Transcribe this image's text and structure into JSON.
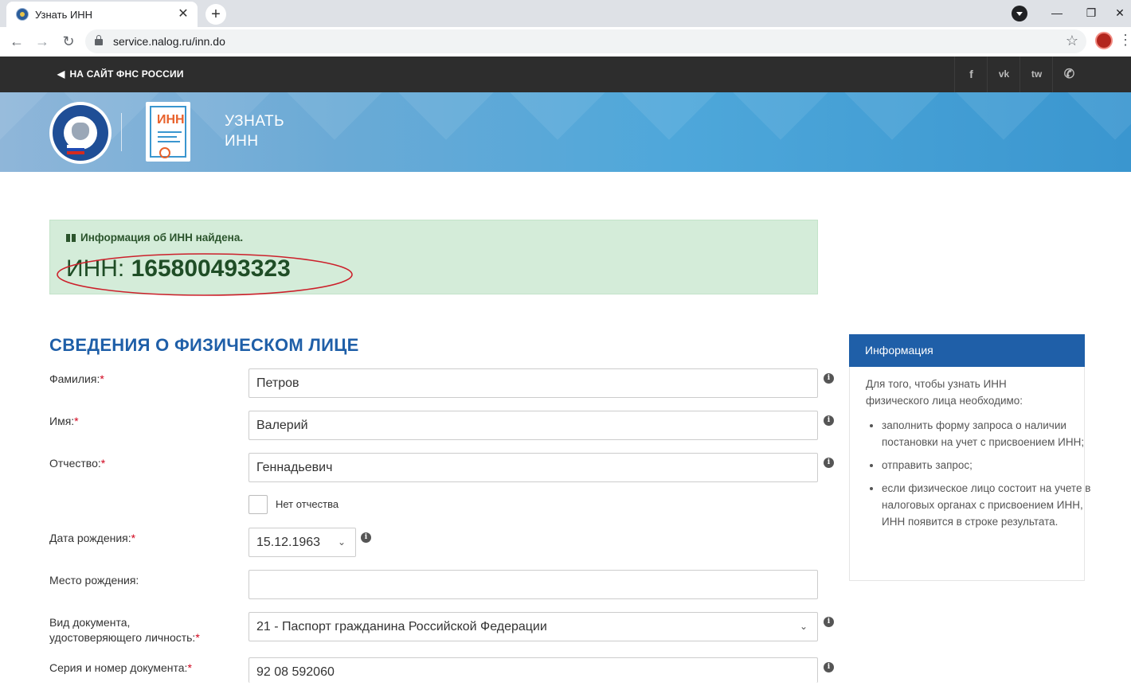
{
  "browser": {
    "tab_title": "Узнать ИНН",
    "tab_close": "✕",
    "new_tab": "+",
    "url": "service.nalog.ru/inn.do",
    "window_min": "—",
    "window_max": "❐",
    "window_close": "✕"
  },
  "topbar": {
    "back_link": "НА САЙТ ФНС РОССИИ",
    "social": [
      "f",
      "vk",
      "tw",
      "phone"
    ]
  },
  "banner": {
    "doc_icon_text": "ИНН",
    "title_line1": "УЗНАТЬ",
    "title_line2": "ИНН"
  },
  "result": {
    "heading": "Информация об ИНН найдена.",
    "inn_label": "ИНН:",
    "inn_value": "165800493323"
  },
  "form": {
    "section_title": "СВЕДЕНИЯ О ФИЗИЧЕСКОМ ЛИЦЕ",
    "surname_label": "Фамилия:",
    "surname_value": "Петров",
    "name_label": "Имя:",
    "name_value": "Валерий",
    "patronymic_label": "Отчество:",
    "patronymic_value": "Геннадьевич",
    "no_patronymic_label": "Нет отчества",
    "birthdate_label": "Дата рождения:",
    "birthdate_value": "15.12.1963",
    "birthplace_label": "Место рождения:",
    "birthplace_value": "",
    "doctype_label_line1": "Вид документа,",
    "doctype_label_line2": "удостоверяющего личность:",
    "doctype_value": "21 - Паспорт гражданина Российской Федерации",
    "docnum_label": "Серия и номер документа:",
    "docnum_value": "92 08 592060",
    "required_mark": "*"
  },
  "info_panel": {
    "title": "Информация",
    "intro": "Для того, чтобы узнать ИНН физического лица необходимо:",
    "items": [
      "заполнить форму запроса о наличии постановки на учет с присвоением ИНН;",
      "отправить запрос;",
      "если физическое лицо состоит на учете в налоговых органах с присвоением ИНН, ИНН появится в строке результата."
    ]
  },
  "colors": {
    "topbar_bg": "#2d2d2d",
    "accent_blue": "#1f5fa8",
    "success_bg": "#d4ecd9",
    "success_text": "#1f4d26",
    "highlight_ellipse": "#cc1f2a"
  }
}
